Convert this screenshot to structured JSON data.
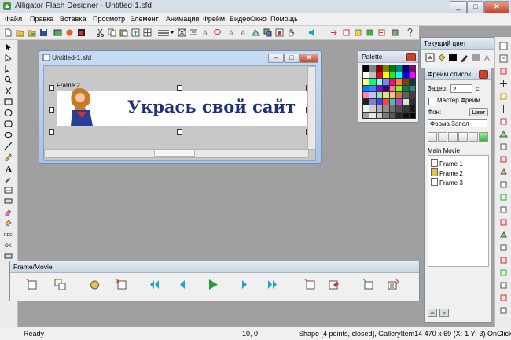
{
  "app": {
    "title": "Alligator Flash Designer - Untitled-1.sfd",
    "minimize": "_",
    "maximize": "□",
    "close": "✕"
  },
  "menu": [
    "Файл",
    "Правка",
    "Вставка",
    "Просмотр",
    "Элемент",
    "Анимация",
    "Фрейм",
    "Видео",
    "Окно",
    "Помощь"
  ],
  "document": {
    "title": "Untitled-1.sfd",
    "frame_label": "Frame 2",
    "banner_text": "Укрась свой сайт"
  },
  "palette": {
    "title": "Palette",
    "colors": [
      "#000000",
      "#808080",
      "#800000",
      "#808000",
      "#008000",
      "#008080",
      "#000080",
      "#800080",
      "#ffffff",
      "#c0c0c0",
      "#ff0000",
      "#ffff00",
      "#00ff00",
      "#00ffff",
      "#0000ff",
      "#ff00ff",
      "#ffff80",
      "#00ff80",
      "#80ffff",
      "#8080ff",
      "#ff0080",
      "#ff8040",
      "#804000",
      "#004040",
      "#0080ff",
      "#4080ff",
      "#8000ff",
      "#400080",
      "#ff8080",
      "#80ff00",
      "#008040",
      "#408080",
      "#ff80c0",
      "#c0c0ff",
      "#a0e0a0",
      "#e0e080",
      "#ffc080",
      "#c08040",
      "#606060",
      "#404040",
      "#202020",
      "#8080c0",
      "#4040ff",
      "#ff4040",
      "#40c0c0",
      "#c040c0",
      "#e0e0e0",
      "#303030",
      "#f0f0f0",
      "#d0d0d0",
      "#b0b0b0",
      "#909090",
      "#707070",
      "#505050",
      "#383838",
      "#181818",
      "#a0a0a0",
      "#e8e8e8",
      "#c8c8c8",
      "#787878",
      "#585858",
      "#282828",
      "#101010",
      "#000000"
    ]
  },
  "color_panel": {
    "title": "Текущий цвет"
  },
  "frame_list": {
    "title": "Фрейм список",
    "delay_label": "Задер:",
    "delay_value": "2",
    "delay_unit": "с.",
    "master_frame_label": "Мастер Фрейм",
    "background_label": "Фон:",
    "color_button": "Цвет",
    "fill_select": "Форма Запол",
    "main_movie": "Main Movie",
    "frames": [
      "Frame 1",
      "Frame 2",
      "Frame 3"
    ]
  },
  "frame_movie": {
    "title": "Frame/Movie"
  },
  "status": {
    "ready": "Ready",
    "coords": "-10, 0",
    "info": "Shape [4 points, closed], GalleryItem14 470 x 69 (X:-1 Y:-3) OnClick: 0"
  },
  "colors": {
    "banner_text": "#1f2f7a",
    "workspace": "#a0a0a0",
    "play": "#21a03a",
    "nav_arrows": "#19a6c8"
  }
}
